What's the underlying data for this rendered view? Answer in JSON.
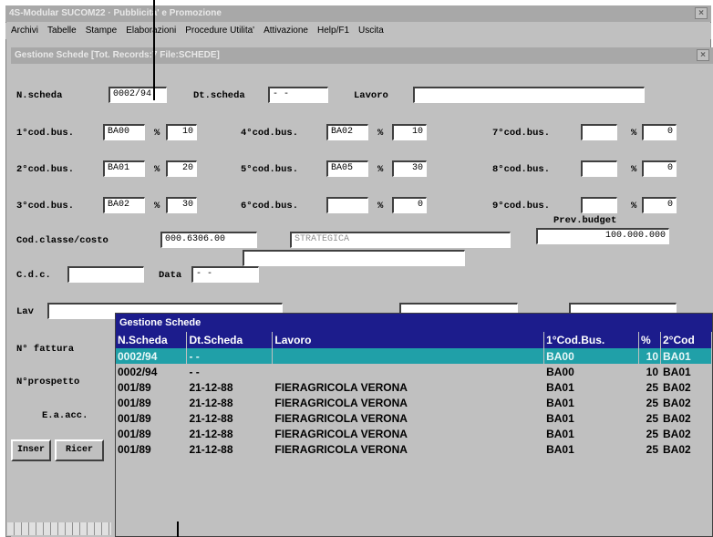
{
  "app_title": "4S-Modular SUCOM22 · Pubblicita' e Promozione",
  "menu": [
    "Archivi",
    "Tabelle",
    "Stampe",
    "Elaborazioni",
    "Procedure Utilita'",
    "Attivazione",
    "Help/F1",
    "Uscita"
  ],
  "inner_title": "Gestione Schede [Tot. Records:7          File:SCHEDE]",
  "form": {
    "nscheda_label": "N.scheda",
    "nscheda_value": "0002/94",
    "dtscheda_label": "Dt.scheda",
    "dtscheda_value": "- -",
    "lavoro_label": "Lavoro",
    "lavoro_value": "",
    "cod1_label": "1°cod.bus.",
    "cod1_value": "BA00",
    "pct1_label": "%",
    "pct1_value": "10",
    "cod2_label": "2°cod.bus.",
    "cod2_value": "BA01",
    "pct2_label": "%",
    "pct2_value": "20",
    "cod3_label": "3°cod.bus.",
    "cod3_value": "BA02",
    "pct3_label": "%",
    "pct3_value": "30",
    "cod4_label": "4°cod.bus.",
    "cod4_value": "BA02",
    "pct4_label": "%",
    "pct4_value": "10",
    "cod5_label": "5°cod.bus.",
    "cod5_value": "BA05",
    "pct5_label": "%",
    "pct5_value": "30",
    "cod6_label": "6°cod.bus.",
    "cod6_value": "",
    "pct6_label": "%",
    "pct6_value": "0",
    "cod7_label": "7°cod.bus.",
    "cod7_value": "",
    "pct7_label": "%",
    "pct7_value": "0",
    "cod8_label": "8°cod.bus.",
    "cod8_value": "",
    "pct8_label": "%",
    "pct8_value": "0",
    "cod9_label": "9°cod.bus.",
    "cod9_value": "",
    "pct9_label": "%",
    "pct9_value": "0",
    "prev_budget_label": "Prev.budget",
    "prev_budget_value": "100.000.000",
    "cod_classe_label": "Cod.classe/costo",
    "cod_classe_value": "000.6306.00",
    "cod_classe_desc": "STRATEGICA",
    "cdc_label": "C.d.c.",
    "cdc_value": "",
    "data_label": "Data",
    "data_value": "- -",
    "lav_label": "Lav",
    "lav_value": "",
    "nfattura_label": "N° fattura",
    "nprospetto_label": "N°prospetto",
    "eacc_label": "E.a.acc.",
    "inser_label": "Inser",
    "ricer_label": "Ricer"
  },
  "popup": {
    "title": "Gestione Schede",
    "headers": [
      "N.Scheda",
      "Dt.Scheda",
      "Lavoro",
      "1°Cod.Bus.",
      "%",
      "2°Cod"
    ],
    "rows": [
      [
        "0002/94",
        "- -",
        "",
        "BA00",
        "10",
        "BA01"
      ],
      [
        "0002/94",
        "- -",
        "",
        "BA00",
        "10",
        "BA01"
      ],
      [
        "001/89",
        "21-12-88",
        "FIERAGRICOLA VERONA",
        "BA01",
        "25",
        "BA02"
      ],
      [
        "001/89",
        "21-12-88",
        "FIERAGRICOLA VERONA",
        "BA01",
        "25",
        "BA02"
      ],
      [
        "001/89",
        "21-12-88",
        "FIERAGRICOLA VERONA",
        "BA01",
        "25",
        "BA02"
      ],
      [
        "001/89",
        "21-12-88",
        "FIERAGRICOLA VERONA",
        "BA01",
        "25",
        "BA02"
      ],
      [
        "001/89",
        "21-12-88",
        "FIERAGRICOLA VERONA",
        "BA01",
        "25",
        "BA02"
      ]
    ],
    "selected_row": 0
  },
  "colors": {
    "popup_title": "#1c1c8c",
    "selected_row": "#20a0a8",
    "window": "#c0c0c0"
  }
}
